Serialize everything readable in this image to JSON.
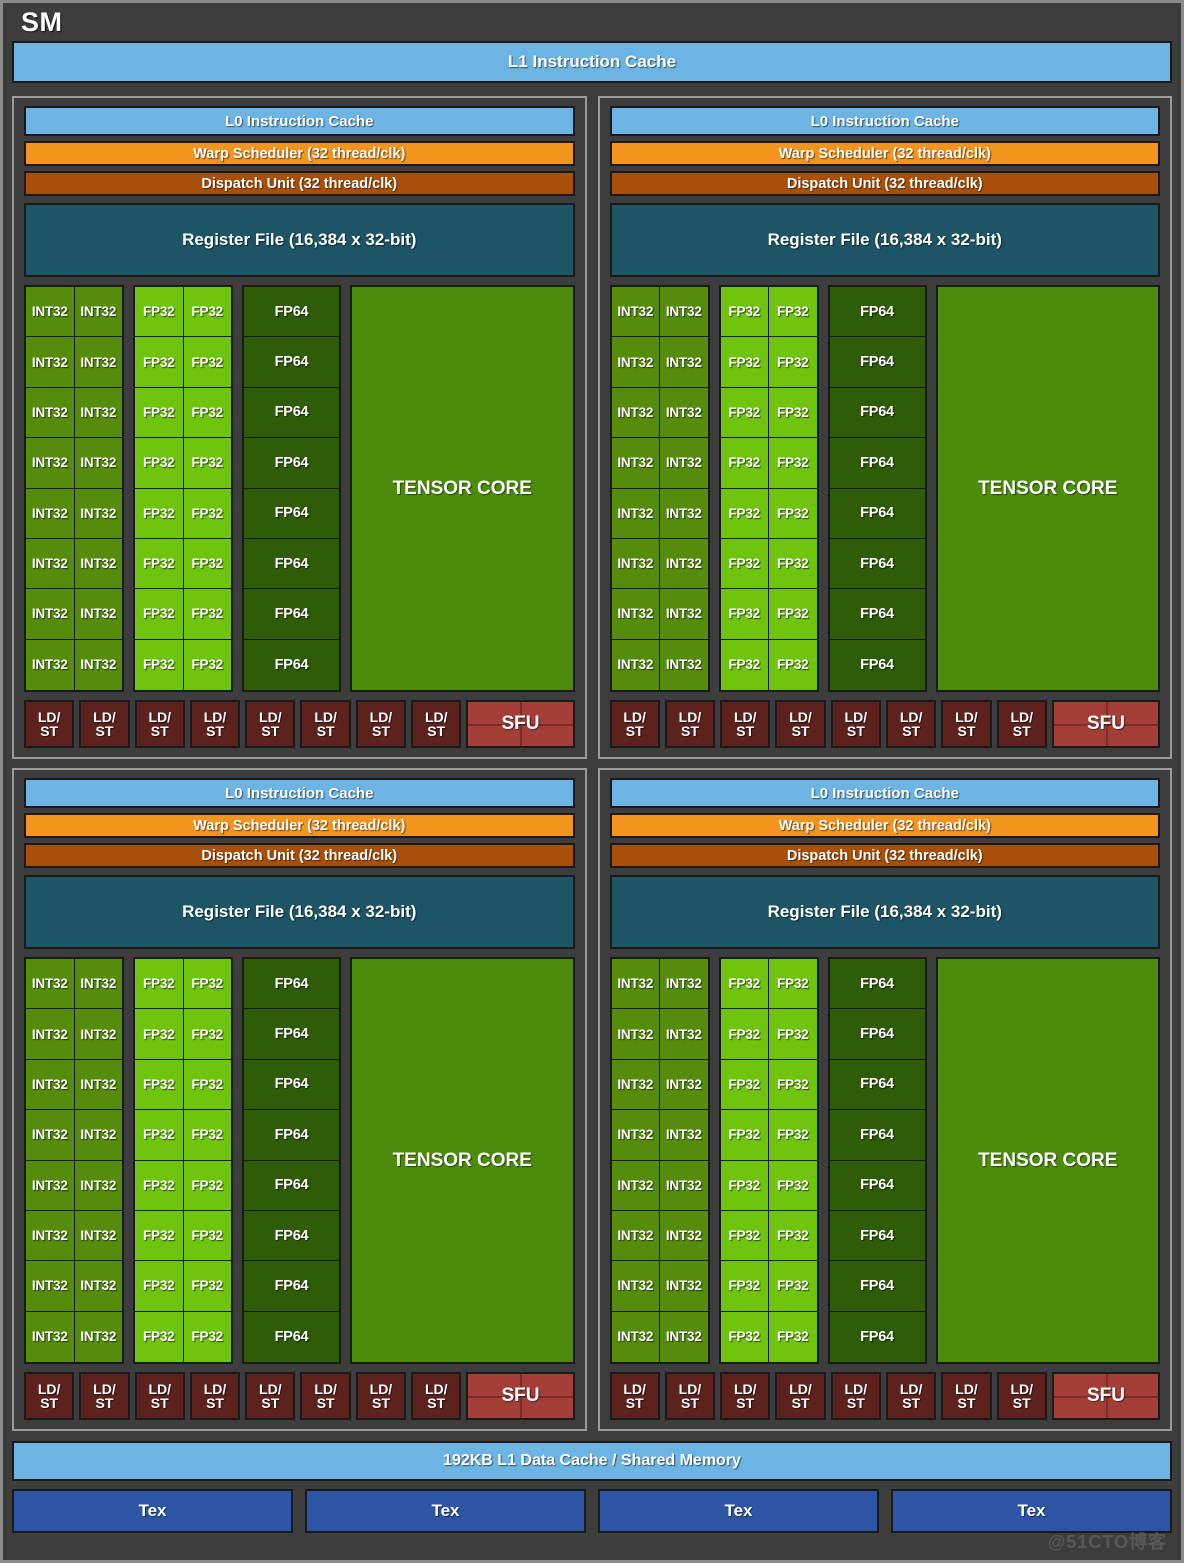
{
  "diagram": {
    "title": "SM",
    "l1_instruction_cache": "L1 Instruction Cache",
    "l1_data_cache": "192KB L1 Data Cache / Shared Memory",
    "watermark": "@51CTO博客",
    "colors": {
      "background": "#3d3d3d",
      "outer_border": "#8c8c8c",
      "quadrant_border": "#9a9a9a",
      "cache_blue": "#6cb4e4",
      "warp_scheduler_orange": "#f2941e",
      "dispatch_unit_brown": "#a8500a",
      "register_file_teal": "#1d5566",
      "int32_green": "#558c0c",
      "fp32_green": "#6fc40d",
      "fp64_green": "#2f5c06",
      "tensor_core_green": "#4c8c0a",
      "ldst_dark_red": "#5e221e",
      "sfu_red": "#a33e38",
      "tex_blue": "#2c55a5"
    }
  },
  "processing_block": {
    "l0_instruction_cache": "L0 Instruction Cache",
    "warp_scheduler": "Warp Scheduler (32 thread/clk)",
    "dispatch_unit": "Dispatch Unit (32 thread/clk)",
    "register_file": "Register File (16,384 x 32-bit)",
    "tensor_core": "TENSOR CORE",
    "ldst_label_top": "LD/",
    "ldst_label_bottom": "ST",
    "sfu": "SFU",
    "unit_labels": {
      "int32": "INT32",
      "fp32": "FP32",
      "fp64": "FP64"
    },
    "counts": {
      "rows": 8,
      "int32_per_row": 2,
      "fp32_per_row": 2,
      "fp64_per_row": 1,
      "ldst_units": 8,
      "sfu_units": 1,
      "quadrants": 4
    }
  },
  "tex_units": [
    "Tex",
    "Tex",
    "Tex",
    "Tex"
  ]
}
